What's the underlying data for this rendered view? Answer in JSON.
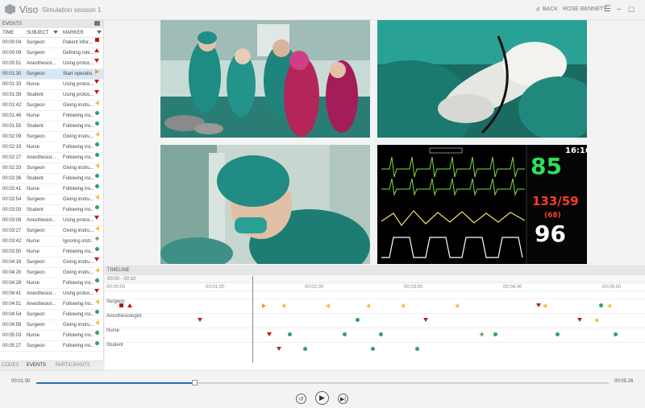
{
  "app": {
    "name": "Viso",
    "session": "Simulation session 1",
    "back_label": "BACK",
    "user": "ROSE BENNETT"
  },
  "events": {
    "title": "EVENTS",
    "columns": {
      "time": "TIME",
      "subject": "SUBJECT",
      "marker": "MARKER"
    },
    "rows": [
      {
        "time": "00:00:04",
        "subject": "Surgeon",
        "marker": "Patient infor...",
        "icon": "sq"
      },
      {
        "time": "00:00:09",
        "subject": "Surgeon",
        "marker": "Defining role...",
        "icon": "tu"
      },
      {
        "time": "00:00:51",
        "subject": "Anesthesiol...",
        "marker": "Using protoc...",
        "icon": "tdn"
      },
      {
        "time": "00:01:30",
        "subject": "Surgeon",
        "marker": "Start operatio...",
        "icon": "tr",
        "selected": true
      },
      {
        "time": "00:01:33",
        "subject": "Nurse",
        "marker": "Using protoc...",
        "icon": "tdn"
      },
      {
        "time": "00:01:39",
        "subject": "Student",
        "marker": "Using protoc...",
        "icon": "tdn"
      },
      {
        "time": "00:01:42",
        "subject": "Surgeon",
        "marker": "Giving instru...",
        "icon": "tl"
      },
      {
        "time": "00:01:46",
        "subject": "Nurse",
        "marker": "Following ins...",
        "icon": "ci"
      },
      {
        "time": "00:01:55",
        "subject": "Student",
        "marker": "Following ins...",
        "icon": "ci"
      },
      {
        "time": "00:02:09",
        "subject": "Surgeon",
        "marker": "Giving instru...",
        "icon": "tl"
      },
      {
        "time": "00:02:19",
        "subject": "Nurse",
        "marker": "Following ins...",
        "icon": "ci"
      },
      {
        "time": "00:02:27",
        "subject": "Anesthesiol...",
        "marker": "Following ins...",
        "icon": "ci"
      },
      {
        "time": "00:02:33",
        "subject": "Surgeon",
        "marker": "Giving instru...",
        "icon": "tl"
      },
      {
        "time": "00:02:36",
        "subject": "Student",
        "marker": "Following ins...",
        "icon": "ci"
      },
      {
        "time": "00:02:41",
        "subject": "Nurse",
        "marker": "Following ins...",
        "icon": "ci"
      },
      {
        "time": "00:02:54",
        "subject": "Surgeon",
        "marker": "Giving instru...",
        "icon": "tl"
      },
      {
        "time": "00:03:03",
        "subject": "Student",
        "marker": "Following ins...",
        "icon": "ci"
      },
      {
        "time": "00:03:08",
        "subject": "Anesthesiol...",
        "marker": "Using protoc...",
        "icon": "tdn"
      },
      {
        "time": "00:03:27",
        "subject": "Surgeon",
        "marker": "Giving instru...",
        "icon": "tl"
      },
      {
        "time": "00:03:42",
        "subject": "Nurse",
        "marker": "Ignoring instr...",
        "icon": "pl"
      },
      {
        "time": "00:03:50",
        "subject": "Nurse",
        "marker": "Following ins...",
        "icon": "ci"
      },
      {
        "time": "00:04:16",
        "subject": "Surgeon",
        "marker": "Giving instru...",
        "icon": "tdn"
      },
      {
        "time": "00:04:20",
        "subject": "Surgeon",
        "marker": "Giving instru...",
        "icon": "tl"
      },
      {
        "time": "00:04:28",
        "subject": "Nurse",
        "marker": "Following ins...",
        "icon": "ci"
      },
      {
        "time": "00:04:41",
        "subject": "Anesthesiol...",
        "marker": "Using protoc...",
        "icon": "tdn"
      },
      {
        "time": "00:04:51",
        "subject": "Anesthesiol...",
        "marker": "Following ins...",
        "icon": "tl"
      },
      {
        "time": "00:04:54",
        "subject": "Surgeon",
        "marker": "Following ins...",
        "icon": "ci"
      },
      {
        "time": "00:04:59",
        "subject": "Surgeon",
        "marker": "Giving instru...",
        "icon": "tl"
      },
      {
        "time": "00:05:03",
        "subject": "Nurse",
        "marker": "Following ins...",
        "icon": "ci"
      },
      {
        "time": "00:05:27",
        "subject": "Surgeon",
        "marker": "Following ins...",
        "icon": "ci"
      }
    ],
    "tabs": [
      "CODES",
      "EVENTS",
      "PARTICIPANTS"
    ]
  },
  "monitor": {
    "hr": "85",
    "bp": "133/59",
    "map": "(68)",
    "spo2": "96",
    "clock": "16:16"
  },
  "timeline": {
    "title": "TIMELINE",
    "range": "00:00 - 00:10",
    "ticks": [
      "00:00:00",
      "00:01:00",
      "00:02:00",
      "00:03:00",
      "00:04:00",
      "00:05:00"
    ],
    "lanes": [
      "Surgeon",
      "Anesthesiologist",
      "Nurse",
      "Student"
    ]
  },
  "player": {
    "current": "00:01:30",
    "total": "00:05:26",
    "progress": 0.276
  }
}
